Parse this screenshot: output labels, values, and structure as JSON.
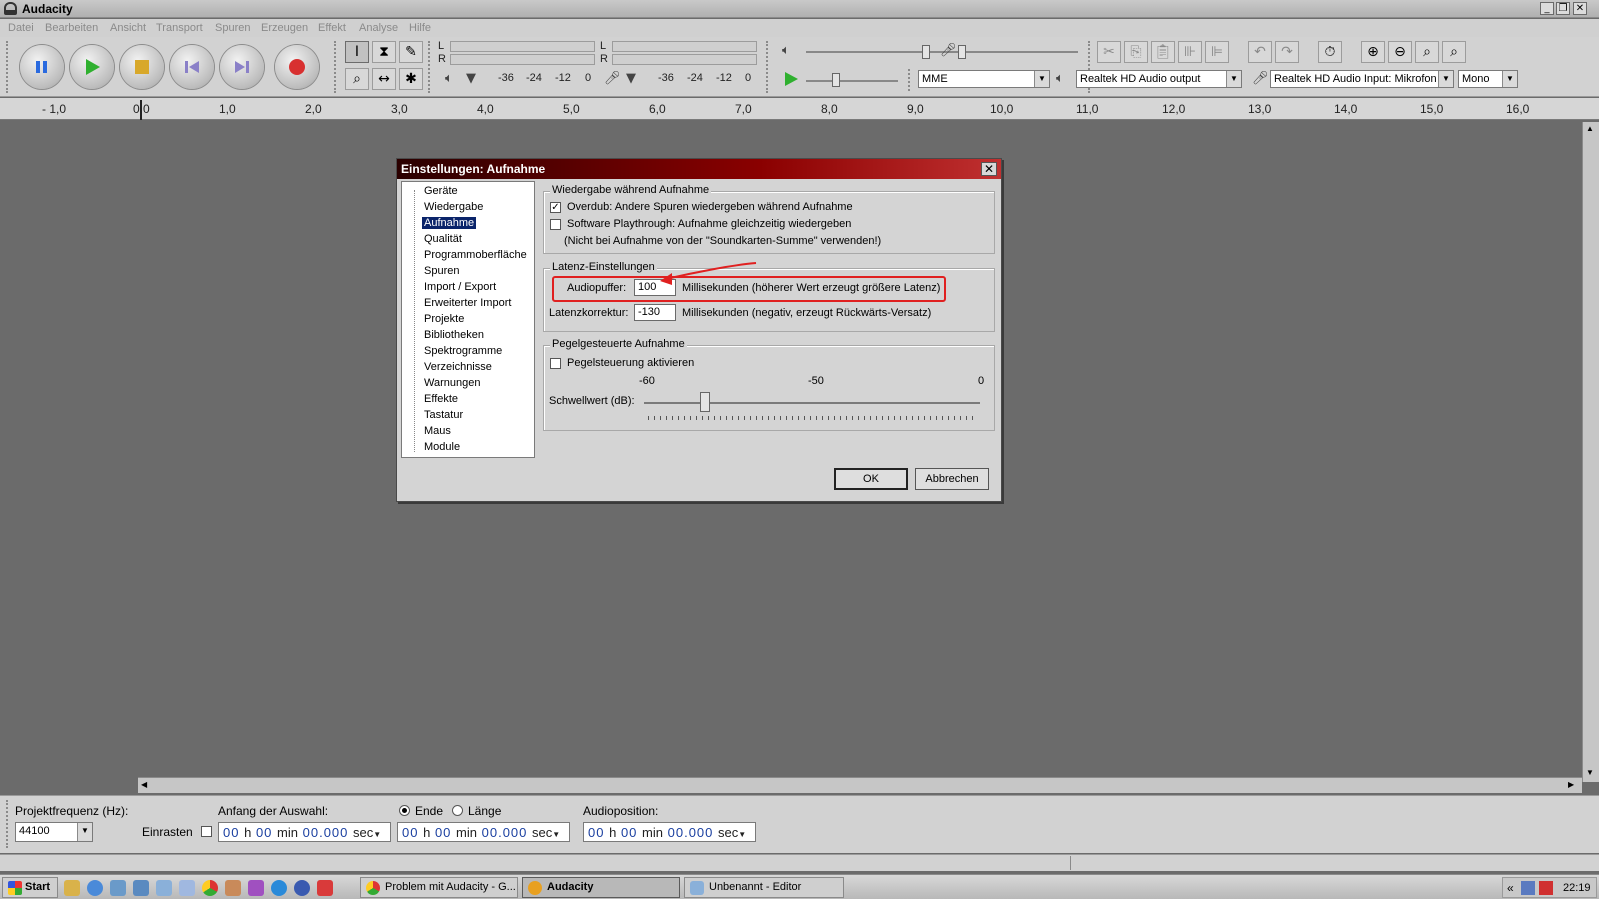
{
  "window": {
    "title": "Audacity"
  },
  "menu": [
    "Datei",
    "Bearbeiten",
    "Ansicht",
    "Transport",
    "Spuren",
    "Erzeugen",
    "Effekt",
    "Analyse",
    "Hilfe"
  ],
  "toolbar": {
    "transport_icons": [
      "pause-icon",
      "play-icon",
      "stop-icon",
      "skip-start-icon",
      "skip-end-icon",
      "record-icon"
    ],
    "meter_ticks_play": [
      "-36",
      "-24",
      "-12",
      "0"
    ],
    "meter_ticks_rec": [
      "-36",
      "-24",
      "-12",
      "0"
    ],
    "meter_lr": [
      "L",
      "R",
      "L",
      "R"
    ],
    "host": "MME",
    "output_device": "Realtek HD Audio output",
    "input_device": "Realtek HD Audio Input: Mikrofon",
    "channels": "Mono"
  },
  "ruler": [
    "- 1,0",
    "0,0",
    "1,0",
    "2,0",
    "3,0",
    "4,0",
    "5,0",
    "6,0",
    "7,0",
    "8,0",
    "9,0",
    "10,0",
    "11,0",
    "12,0",
    "13,0",
    "14,0",
    "15,0",
    "16,0"
  ],
  "dialog": {
    "title": "Einstellungen: Aufnahme",
    "tree": [
      "Geräte",
      "Wiedergabe",
      "Aufnahme",
      "Qualität",
      "Programmoberfläche",
      "Spuren",
      "Import / Export",
      "Erweiterter Import",
      "Projekte",
      "Bibliotheken",
      "Spektrogramme",
      "Verzeichnisse",
      "Warnungen",
      "Effekte",
      "Tastatur",
      "Maus",
      "Module"
    ],
    "selected": "Aufnahme",
    "playthrough": {
      "group": "Wiedergabe während Aufnahme",
      "overdub": "Overdub: Andere Spuren wiedergeben während Aufnahme",
      "overdub_checked": true,
      "software": "Software Playthrough: Aufnahme gleichzeitig wiedergeben",
      "software_checked": false,
      "note": "(Nicht bei Aufnahme von der \"Soundkarten-Summe\" verwenden!)"
    },
    "latency": {
      "group": "Latenz-Einstellungen",
      "buffer_label": "Audiopuffer:",
      "buffer_value": "100",
      "buffer_desc": "Millisekunden (höherer Wert erzeugt größere Latenz)",
      "correction_label": "Latenzkorrektur:",
      "correction_value": "-130",
      "correction_desc": "Millisekunden (negativ, erzeugt Rückwärts-Versatz)"
    },
    "voice": {
      "group": "Pegelgesteuerte Aufnahme",
      "enable": "Pegelsteuerung aktivieren",
      "enable_checked": false,
      "scale": [
        "-60",
        "-50",
        "0"
      ],
      "threshold_label": "Schwellwert (dB):",
      "threshold_value": -57
    },
    "ok": "OK",
    "cancel": "Abbrechen"
  },
  "selection": {
    "rate_label": "Projektfrequenz (Hz):",
    "rate": "44100",
    "snap": "Einrasten",
    "start_label": "Anfang der Auswahl:",
    "end": "Ende",
    "length": "Länge",
    "audiopos_label": "Audioposition:",
    "time": {
      "h": "00",
      "hu": "h",
      "m": "00",
      "mu": "min",
      "s": "00.000",
      "su": "sec"
    }
  },
  "taskbar": {
    "start": "Start",
    "tasks": [
      "Problem mit Audacity - G...",
      "Audacity",
      "Unbenannt - Editor"
    ],
    "clock": "22:19",
    "tray": "«"
  }
}
